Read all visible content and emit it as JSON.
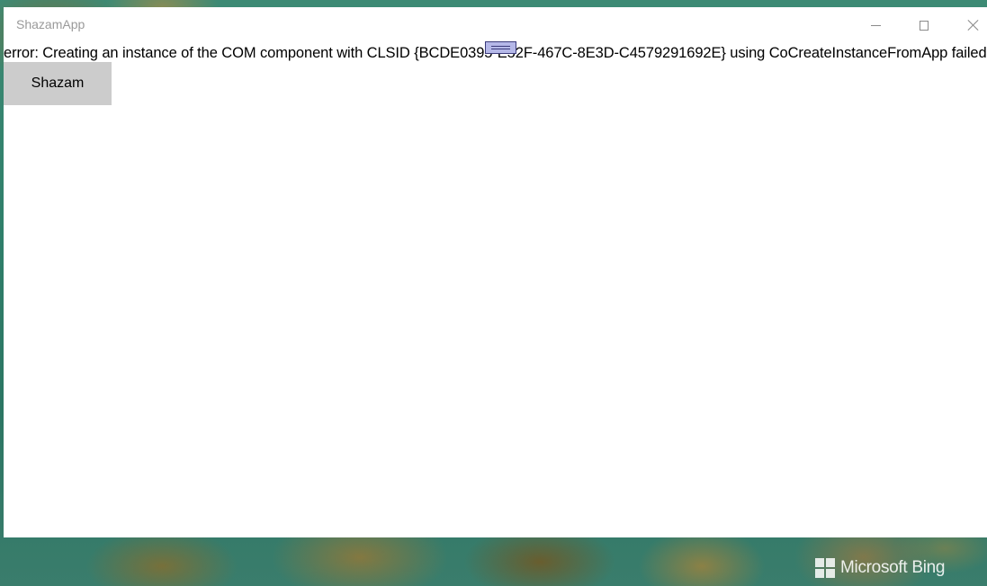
{
  "window": {
    "title": "ShazamApp"
  },
  "content": {
    "error_message": "error: Creating an instance of the COM component with CLSID {BCDE0395-E52F-467C-8E3D-C4579291692E} using CoCreateInstanceFromApp failed",
    "shazam_button_label": "Shazam"
  },
  "caption_buttons": {
    "minimize": "minimize-icon",
    "maximize": "maximize-icon",
    "close": "close-icon"
  },
  "desktop": {
    "watermark": "Microsoft Bing"
  },
  "colors": {
    "window_bg": "#ffffff",
    "title_text": "#9a9a9a",
    "button_bg": "#cccccc"
  }
}
